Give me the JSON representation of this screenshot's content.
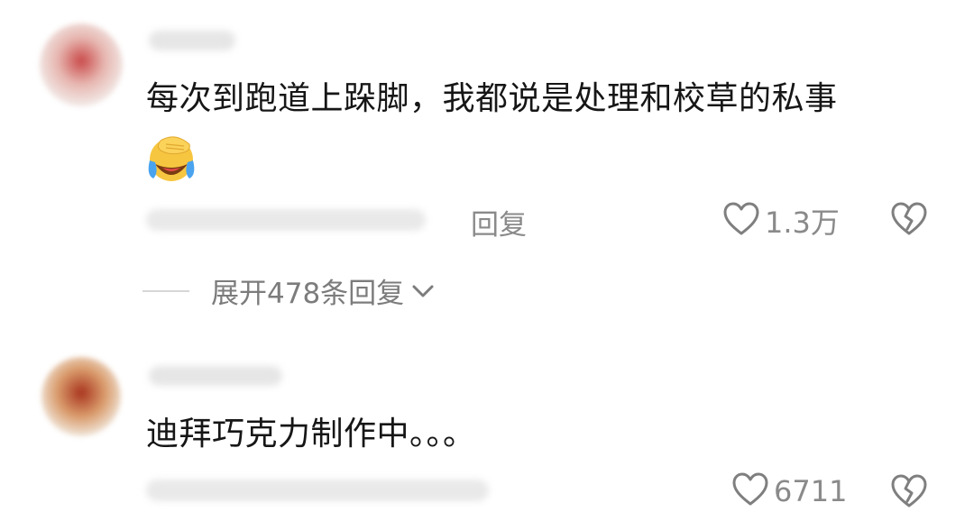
{
  "comments": [
    {
      "text": "每次到跑道上跺脚，我都说是处理和校草的私事",
      "emoji": "facepalm-crying-emoji",
      "reply_label": "回复",
      "like_count": "1.3万"
    },
    {
      "text": "迪拜巧克力制作中。。。",
      "like_count": "6711"
    }
  ],
  "expand_replies_label": "展开478条回复",
  "icons": {
    "like": "heart-outline-icon",
    "dislike": "broken-heart-icon",
    "expand": "chevron-down-icon"
  },
  "colors": {
    "text": "#161616",
    "meta": "#8a8a8a",
    "emoji_yellow": "#f7c640",
    "emoji_tear": "#4aa3ee"
  }
}
